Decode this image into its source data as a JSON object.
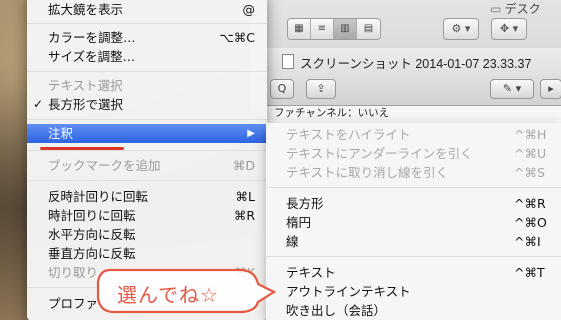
{
  "finder": {
    "title": "デスク",
    "seg_view_icons": [
      "▦",
      "≡",
      "▥",
      "▤"
    ],
    "action_icon": "⚙ ▾",
    "dropbox_icon": "✥ ▾"
  },
  "preview": {
    "title": "スクリーンショット 2014-01-07 23.33.37",
    "status": "ファチャンネル：いいえ",
    "zoom_out_icon": "Q",
    "share_icon": "⇪",
    "edit_icon": "✎ ▾",
    "more_icon": "▸"
  },
  "menu": {
    "items": [
      {
        "label": "拡大鏡を表示",
        "shortcut": "@"
      },
      {
        "label": "カラーを調整…",
        "shortcut": "⌥⌘C"
      },
      {
        "label": "サイズを調整…",
        "shortcut": ""
      },
      {
        "label": "テキスト選択",
        "shortcut": ""
      },
      {
        "label": "長方形で選択",
        "shortcut": "",
        "check": "✓"
      },
      {
        "label": "注釈",
        "shortcut": "▶"
      },
      {
        "label": "ブックマークを追加",
        "shortcut": "⌘D"
      },
      {
        "label": "反時計回りに回転",
        "shortcut": "⌘L"
      },
      {
        "label": "時計回りに回転",
        "shortcut": "⌘R"
      },
      {
        "label": "水平方向に反転",
        "shortcut": ""
      },
      {
        "label": "垂直方向に反転",
        "shortcut": ""
      },
      {
        "label": "切り取り",
        "shortcut": "⌘K"
      },
      {
        "label": "プロファ",
        "shortcut": ""
      }
    ]
  },
  "submenu": {
    "items": [
      {
        "label": "テキストをハイライト",
        "shortcut": "^⌘H"
      },
      {
        "label": "テキストにアンダーラインを引く",
        "shortcut": "^⌘U"
      },
      {
        "label": "テキストに取り消し線を引く",
        "shortcut": "^⌘S"
      },
      {
        "label": "長方形",
        "shortcut": "^⌘R"
      },
      {
        "label": "楕円",
        "shortcut": "^⌘O"
      },
      {
        "label": "線",
        "shortcut": "^⌘I"
      },
      {
        "label": "テキスト",
        "shortcut": "^⌘T"
      },
      {
        "label": "アウトラインテキスト",
        "shortcut": ""
      },
      {
        "label": "吹き出し（会話）",
        "shortcut": ""
      }
    ]
  },
  "annotation": {
    "bubble_text": "選んでね☆",
    "color": "#e45844"
  }
}
